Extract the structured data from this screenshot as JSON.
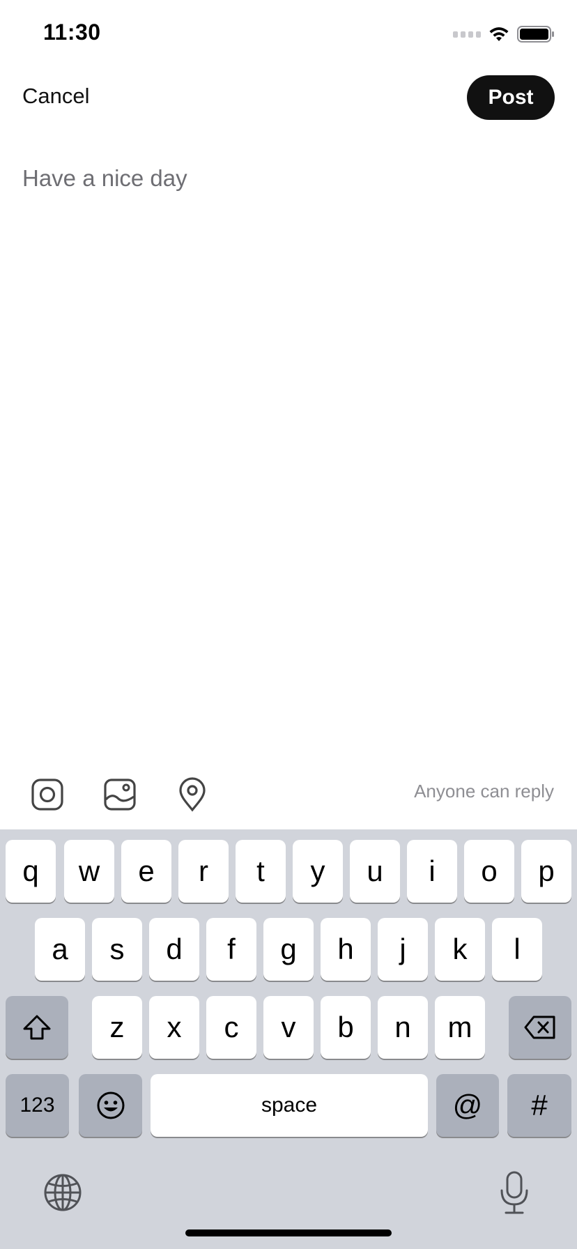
{
  "status_bar": {
    "time": "11:30",
    "icons": [
      "cellular-signal-icon",
      "wifi-icon",
      "battery-icon"
    ]
  },
  "nav": {
    "cancel_label": "Cancel",
    "post_label": "Post"
  },
  "composer": {
    "placeholder": "Have a nice day",
    "value": ""
  },
  "toolbar": {
    "icons": [
      "camera-icon",
      "photo-library-icon",
      "location-pin-icon"
    ],
    "reply_setting": "Anyone can reply"
  },
  "keyboard": {
    "row1": [
      "q",
      "w",
      "e",
      "r",
      "t",
      "y",
      "u",
      "i",
      "o",
      "p"
    ],
    "row2": [
      "a",
      "s",
      "d",
      "f",
      "g",
      "h",
      "j",
      "k",
      "l"
    ],
    "row3": [
      "z",
      "x",
      "c",
      "v",
      "b",
      "n",
      "m"
    ],
    "numbers_label": "123",
    "space_label": "space",
    "at_label": "@",
    "hash_label": "#",
    "icons": [
      "shift-icon",
      "backspace-icon",
      "emoji-icon",
      "globe-icon",
      "microphone-icon"
    ]
  },
  "colors": {
    "accent": "#111111",
    "keyboard_bg": "#d1d4db",
    "key_dark": "#abb0bb",
    "placeholder": "#6e6e73",
    "secondary_text": "#8e8e93"
  }
}
